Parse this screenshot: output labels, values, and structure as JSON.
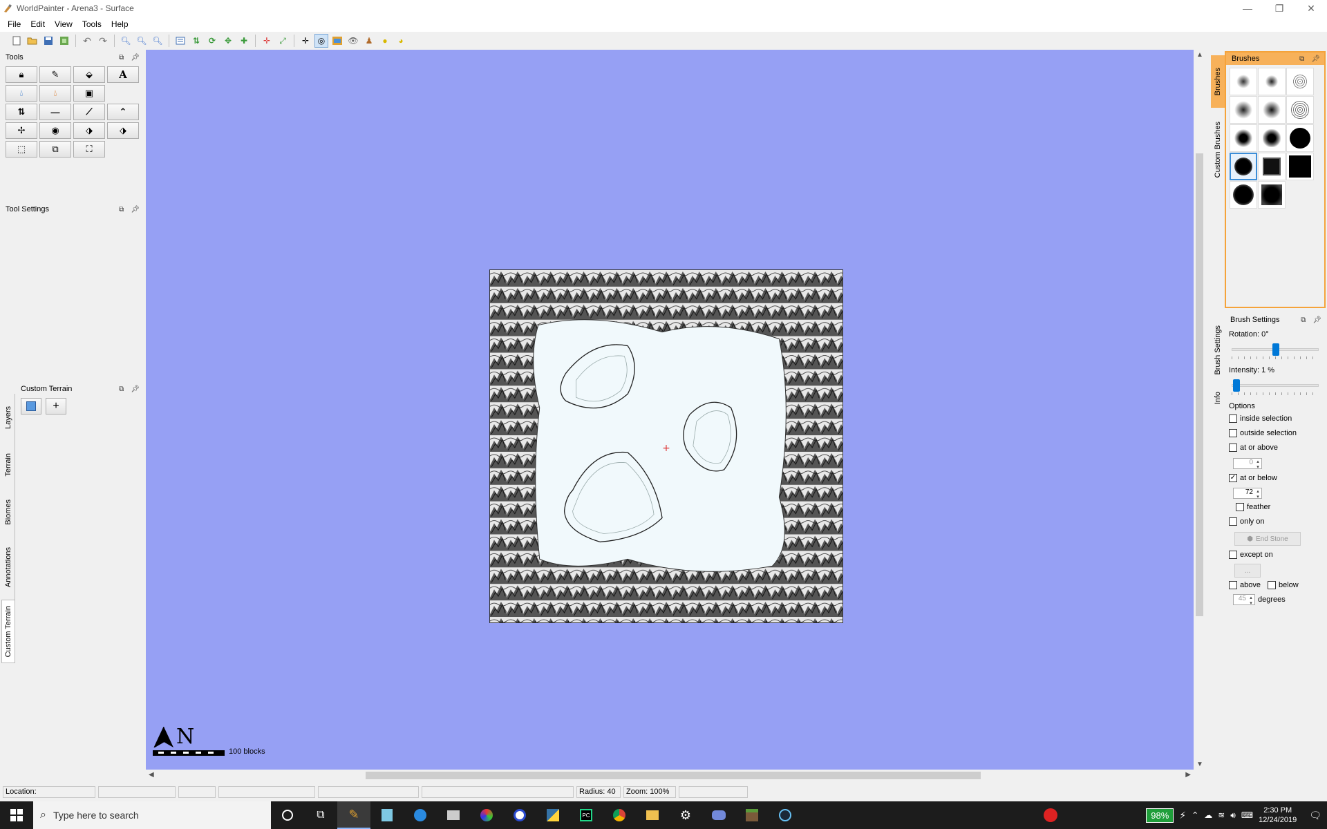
{
  "window": {
    "title": "WorldPainter - Arena3 - Surface",
    "minimize_icon": "minimize-icon",
    "restore_icon": "restore-icon",
    "close_icon": "close-icon"
  },
  "menu": [
    "File",
    "Edit",
    "View",
    "Tools",
    "Help"
  ],
  "tools_panel": {
    "title": "Tools",
    "text_tool_glyph": "A"
  },
  "tool_settings_panel": {
    "title": "Tool Settings"
  },
  "custom_terrain_panel": {
    "title": "Custom Terrain",
    "add_glyph": "+"
  },
  "left_tabs": [
    "Layers",
    "Terrain",
    "Biomes",
    "Annotations",
    "Custom Terrain"
  ],
  "right_tabs": [
    "Brushes",
    "Custom Brushes",
    "Brush Settings",
    "Info"
  ],
  "brushes_panel": {
    "title": "Brushes",
    "selected_index": 9
  },
  "brush_settings": {
    "title": "Brush Settings",
    "rotation_label": "Rotation: 0°",
    "rotation_value": 0.5,
    "intensity_label": "Intensity: 1 %",
    "intensity_value": 0.01,
    "options_label": "Options",
    "inside_selection": "inside selection",
    "outside_selection": "outside selection",
    "at_or_above": "at or above",
    "at_or_above_value": "0",
    "at_or_below": "at or below",
    "at_or_below_value": "72",
    "feather": "feather",
    "only_on": "only on",
    "only_on_value": "End Stone",
    "except_on": "except on",
    "except_on_value": "...",
    "above": "above",
    "below": "below",
    "degrees_value": "45",
    "degrees": "degrees"
  },
  "canvas": {
    "background": "#96a0f4",
    "scale_label": "100 blocks",
    "north_label": "N"
  },
  "statusbar": {
    "location": "Location:",
    "radius": "Radius: 40",
    "zoom": "Zoom: 100%"
  },
  "taskbar": {
    "search_placeholder": "Type here to search",
    "battery": "98%",
    "time": "2:30 PM",
    "date": "12/24/2019"
  }
}
